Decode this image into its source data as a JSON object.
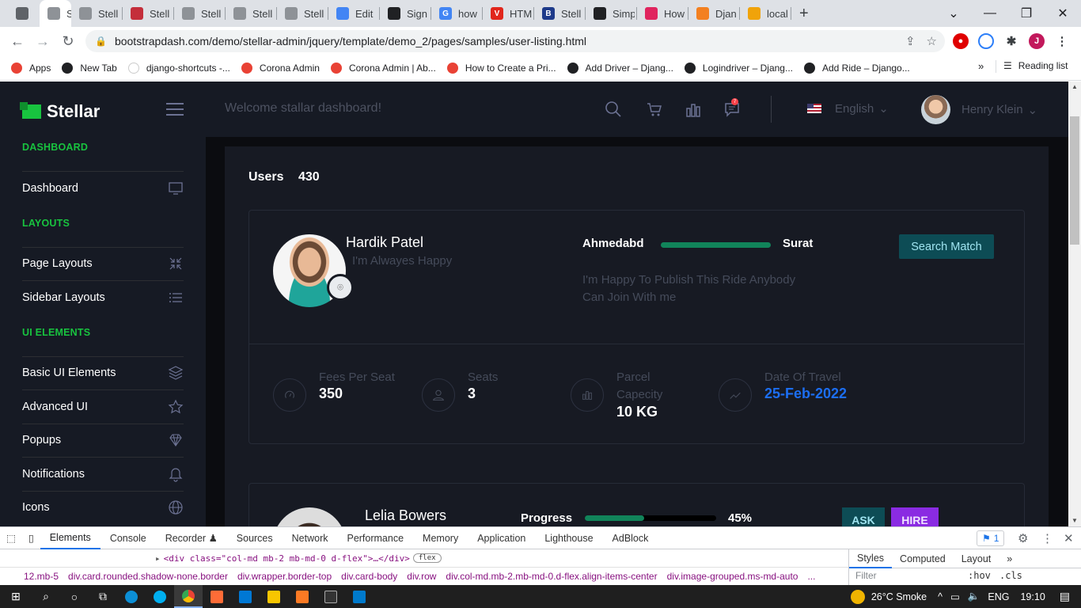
{
  "browser": {
    "tabs": [
      {
        "label": "",
        "color": "#5f6368",
        "glyph": ""
      },
      {
        "label": "Stell",
        "color": "#8e9297",
        "glyph": ""
      },
      {
        "label": "Stell",
        "color": "#8e9297",
        "glyph": ""
      },
      {
        "label": "Stell",
        "color": "#c42e3b",
        "glyph": ""
      },
      {
        "label": "Stell",
        "color": "#8e9297",
        "glyph": ""
      },
      {
        "label": "Stell",
        "color": "#8e9297",
        "glyph": ""
      },
      {
        "label": "Stell",
        "color": "#8e9297",
        "glyph": ""
      },
      {
        "label": "Edit",
        "color": "#4285f4",
        "glyph": ""
      },
      {
        "label": "Sign",
        "color": "#202124",
        "glyph": ""
      },
      {
        "label": "how",
        "color": "#4285f4",
        "glyph": "G"
      },
      {
        "label": "HTM",
        "color": "#e1261c",
        "glyph": "V"
      },
      {
        "label": "Stell",
        "color": "#1e3a8a",
        "glyph": "B"
      },
      {
        "label": "Simp",
        "color": "#202124",
        "glyph": ""
      },
      {
        "label": "How",
        "color": "#e0245e",
        "glyph": ""
      },
      {
        "label": "Djan",
        "color": "#f38020",
        "glyph": ""
      },
      {
        "label": "local",
        "color": "#f0a30a",
        "glyph": ""
      }
    ],
    "url": "bootstrapdash.com/demo/stellar-admin/jquery/template/demo_2/pages/samples/user-listing.html",
    "profile_initial": "J",
    "bookmarks": [
      {
        "label": "Apps",
        "color": "#e94235"
      },
      {
        "label": "New Tab",
        "color": "#202124"
      },
      {
        "label": "django-shortcuts -...",
        "color": "#ffffff"
      },
      {
        "label": "Corona Admin",
        "color": "#e94235"
      },
      {
        "label": "Corona Admin | Ab...",
        "color": "#e94235"
      },
      {
        "label": "How to Create a Pri...",
        "color": "#e94235"
      },
      {
        "label": "Add Driver – Djang...",
        "color": "#202124"
      },
      {
        "label": "Logindriver – Djang...",
        "color": "#202124"
      },
      {
        "label": "Add Ride – Django...",
        "color": "#202124"
      }
    ],
    "more_bookmarks": "»",
    "reading_list": "Reading list"
  },
  "sidebar": {
    "brand": "Stellar",
    "sections": [
      {
        "heading": "DASHBOARD",
        "items": [
          {
            "label": "Dashboard",
            "icon": "monitor-icon"
          }
        ]
      },
      {
        "heading": "LAYOUTS",
        "items": [
          {
            "label": "Page Layouts",
            "icon": "collapse-icon"
          },
          {
            "label": "Sidebar Layouts",
            "icon": "list-icon"
          }
        ]
      },
      {
        "heading": "UI ELEMENTS",
        "items": [
          {
            "label": "Basic UI Elements",
            "icon": "layers-icon"
          },
          {
            "label": "Advanced UI",
            "icon": "star-icon"
          },
          {
            "label": "Popups",
            "icon": "diamond-icon"
          },
          {
            "label": "Notifications",
            "icon": "bell-icon"
          },
          {
            "label": "Icons",
            "icon": "globe-icon"
          }
        ]
      }
    ]
  },
  "navbar": {
    "welcome": "Welcome stallar dashboard!",
    "language": "English",
    "user_name": "Henry Klein",
    "badge_count": "7"
  },
  "main": {
    "users_label": "Users",
    "users_count": "430",
    "ride_card": {
      "name": "Hardik Patel",
      "status": "I'm Alwayes Happy",
      "from": "Ahmedabd",
      "to": "Surat",
      "description": "I'm Happy To Publish This Ride Anybody Can Join With me",
      "button": "Search Match",
      "stats": [
        {
          "label": "Fees Per Seat",
          "value": "350",
          "icon": "speedometer-icon"
        },
        {
          "label": "Seats",
          "value": "3",
          "icon": "user-icon"
        },
        {
          "label": "Parcel Capecity",
          "value": "10 KG",
          "icon": "bar-chart-icon"
        },
        {
          "label": "Date Of Travel",
          "value": "25-Feb-2022",
          "icon": "trend-icon"
        }
      ]
    },
    "user_card": {
      "name": "Lelia Bowers",
      "progress_label": "Progress",
      "progress_percent": 45,
      "progress_text": "45%",
      "ask": "ASK",
      "hire": "HIRE"
    }
  },
  "devtools": {
    "tabs": [
      "Elements",
      "Console",
      "Recorder ♟",
      "Sources",
      "Network",
      "Performance",
      "Memory",
      "Application",
      "Lighthouse",
      "AdBlock"
    ],
    "issues_count": "1",
    "dom_line": "<div class=\"col-md mb-2 mb-md-0 d-flex\">…</div>",
    "dom_badge": "flex",
    "breadcrumbs": [
      "12.mb-5",
      "div.card.rounded.shadow-none.border",
      "div.wrapper.border-top",
      "div.card-body",
      "div.row",
      "div.col-md.mb-2.mb-md-0.d-flex.align-items-center",
      "div.image-grouped.ms-md-auto",
      "..."
    ],
    "styles_tabs": [
      "Styles",
      "Computed",
      "Layout",
      "»"
    ],
    "filter_placeholder": "Filter",
    "hov": ":hov",
    "cls": ".cls"
  },
  "taskbar": {
    "weather": "26°C Smoke",
    "lang": "ENG",
    "time": "19:10"
  }
}
